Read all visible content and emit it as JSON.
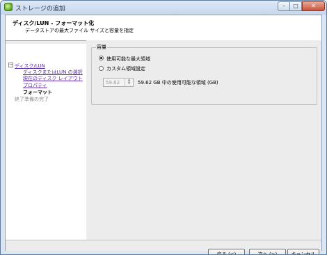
{
  "window": {
    "title": "ストレージの追加",
    "controls": {
      "minimize": "–",
      "maximize": "□",
      "close": "✕"
    }
  },
  "header": {
    "title": "ディスク/LUN - フォーマット化",
    "subtitle": "データストアの最大ファイル サイズと容量を指定"
  },
  "nav": {
    "toggle": "−",
    "items": [
      {
        "label": "ディスク/LUN",
        "state": "link"
      },
      {
        "label": "ディスクまたはLUN の選択",
        "state": "link"
      },
      {
        "label": "現在のディスク レイアウト",
        "state": "link"
      },
      {
        "label": "プロパティ",
        "state": "link"
      },
      {
        "label": "フォーマット",
        "state": "current"
      },
      {
        "label": "終了準備の完了",
        "state": "disabled"
      }
    ]
  },
  "capacity": {
    "group_title": "容量",
    "options": [
      {
        "label": "使用可能な最大領域",
        "selected": true
      },
      {
        "label": "カスタム領域設定",
        "selected": false
      }
    ],
    "custom_value": "59.62",
    "custom_value_label": "59.62 GB 中の使用可能な領域 (GB)"
  },
  "buttons": {
    "back": "戻る (<)",
    "next": "次へ (>)",
    "cancel": "キャンセル"
  }
}
